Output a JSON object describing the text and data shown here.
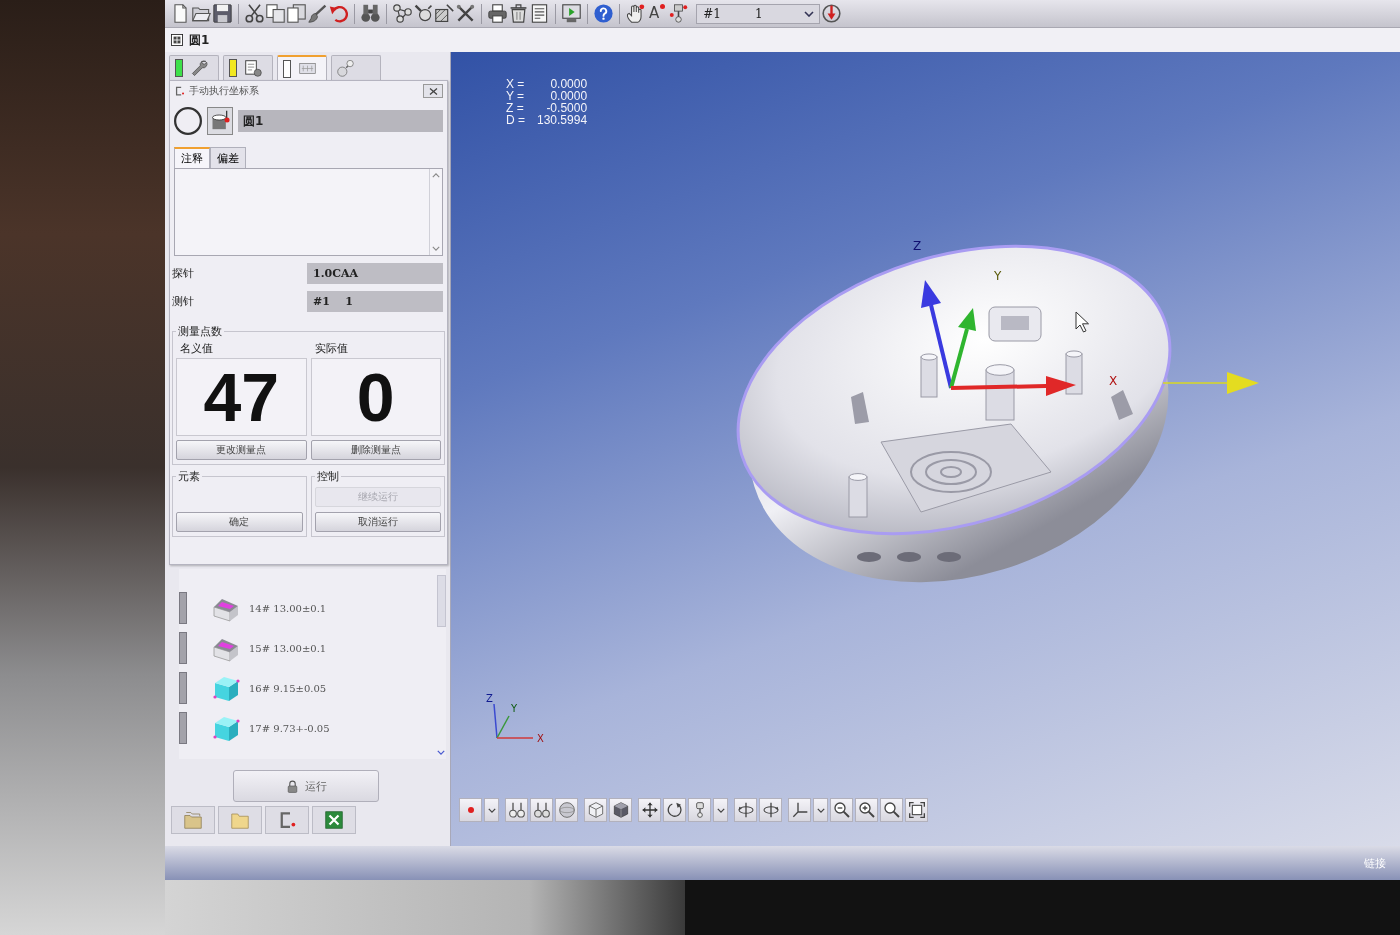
{
  "toolbar": {
    "letter_button": "A",
    "dropdown": {
      "texts": [
        "#1",
        "1"
      ]
    }
  },
  "feature_bar": {
    "name": "圆1"
  },
  "side_tabs": [
    {
      "selected": false,
      "color": "#3ee04a"
    },
    {
      "selected": false,
      "color": "#f2e820"
    },
    {
      "selected": true,
      "color": "#ffffff"
    },
    {
      "selected": false
    }
  ],
  "dialog": {
    "title": "手动执行坐标系",
    "feature_name": "圆1",
    "tabs": [
      {
        "label": "注释",
        "selected": true
      },
      {
        "label": "偏差",
        "selected": false
      }
    ],
    "fields": [
      {
        "label": "探针",
        "value": "1.0CAA"
      },
      {
        "label": "测针",
        "value": "#1    1"
      }
    ],
    "points": {
      "title": "测量点数",
      "counts": [
        {
          "label": "名义值",
          "value": "47"
        },
        {
          "label": "实际值",
          "value": "0"
        }
      ],
      "buttons": [
        {
          "label": "更改测量点",
          "disabled": false
        },
        {
          "label": "删除测量点",
          "disabled": false
        }
      ]
    },
    "groups": [
      {
        "title": "元素",
        "buttons": [
          {
            "label": "确定",
            "disabled": false
          }
        ]
      },
      {
        "title": "控制",
        "buttons": [
          {
            "label": "继续运行",
            "disabled": true
          },
          {
            "label": "取消运行",
            "disabled": false
          }
        ]
      }
    ]
  },
  "feature_list": [
    {
      "kind": "block",
      "text": "14# 13.00±0.1"
    },
    {
      "kind": "block",
      "text": "15# 13.00±0.1"
    },
    {
      "kind": "cube",
      "text": "16# 9.15±0.05"
    },
    {
      "kind": "cube",
      "text": "17# 9.73+-0.05"
    }
  ],
  "run_button": {
    "label": "运行"
  },
  "readout": [
    {
      "axis": "X =",
      "value": "0.0000"
    },
    {
      "axis": "Y =",
      "value": "0.0000"
    },
    {
      "axis": "Z =",
      "value": "-0.5000"
    },
    {
      "axis": "D =",
      "value": "130.5994"
    }
  ],
  "viewport": {
    "model_axis_labels": [
      "Z",
      "Y",
      "X"
    ],
    "corner_axis_labels": [
      "Z",
      "Y",
      "X"
    ]
  },
  "status_bar": {
    "text": "链接"
  }
}
